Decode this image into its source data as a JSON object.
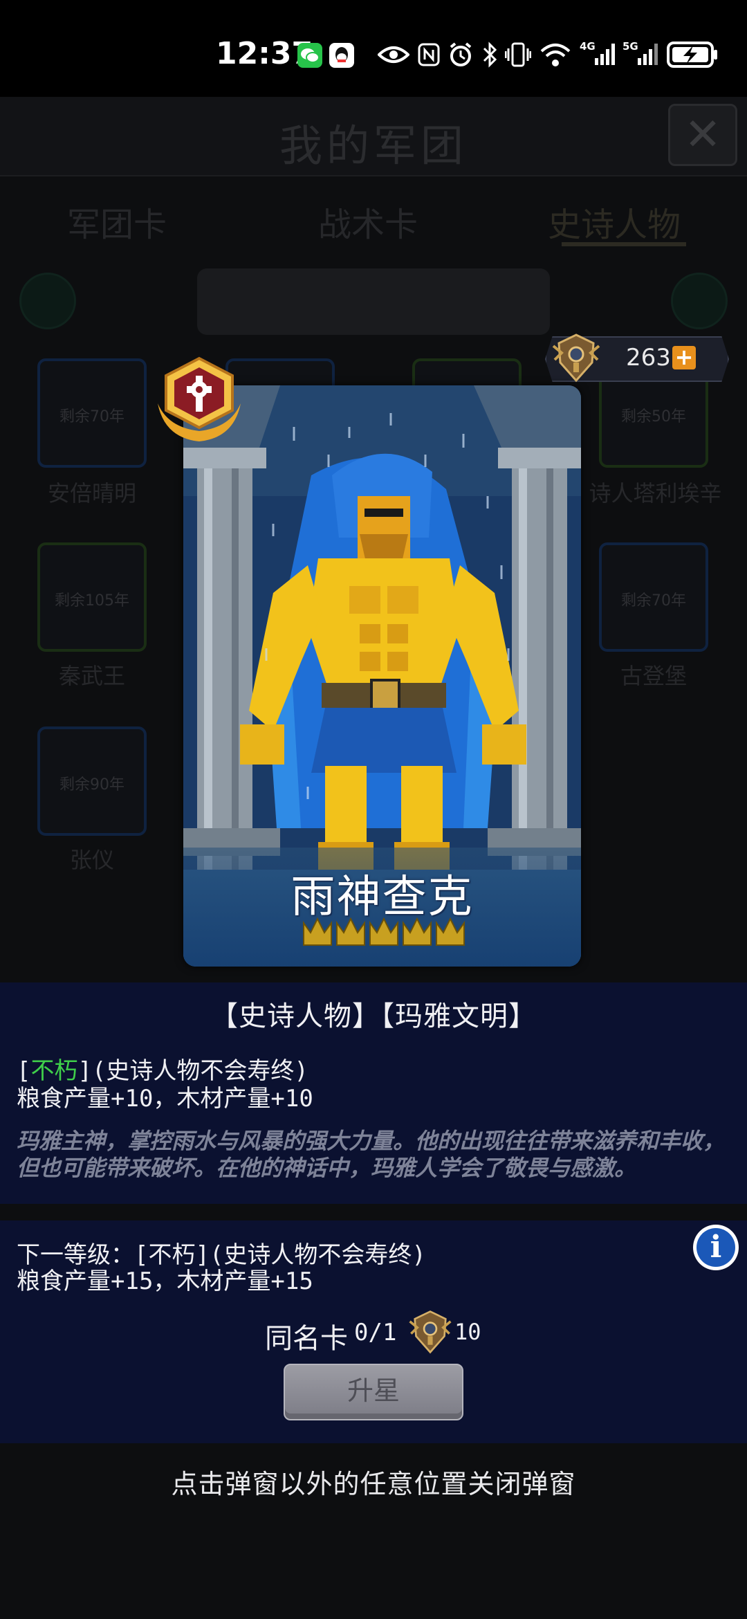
{
  "status_bar": {
    "time": "12:37"
  },
  "background": {
    "title": "我的军团",
    "tabs": [
      "军团卡",
      "战术卡",
      "史诗人物"
    ],
    "cards": [
      {
        "remaining": "剩余70年",
        "name": "安倍晴明"
      },
      {
        "remaining": "剩余50年",
        "name": "诗人塔利埃辛"
      },
      {
        "remaining": "剩余105年",
        "name": "秦武王"
      },
      {
        "remaining": "剩余70年",
        "name": "古登堡"
      },
      {
        "remaining": "剩余90年",
        "name": "张仪"
      }
    ]
  },
  "currency": {
    "value": "263",
    "plus_symbol": "+"
  },
  "hero": {
    "name": "雨神查克",
    "stars": 5
  },
  "details": {
    "tags": "【史诗人物】【玛雅文明】",
    "trait_open": "[",
    "trait_name": "不朽",
    "trait_close": "](史诗人物不会寿终)",
    "yield": "粮食产量+10，木材产量+10",
    "lore": "玛雅主神，掌控雨水与风暴的强大力量。他的出现往往带来滋养和丰收，但也可能带来破坏。在他的神话中，玛雅人学会了敬畏与感激。"
  },
  "upgrade": {
    "next_level": "下一等级：[不朽](史诗人物不会寿终)",
    "next_yield": "粮食产量+15，木材产量+15",
    "dup_label": "同名卡",
    "dup_count": "0/1",
    "cost": "10",
    "star_button": "升星"
  },
  "hint": "点击弹窗以外的任意位置关闭弹窗",
  "colors": {
    "panel_bg": "#0b1130",
    "trait_green": "#3fcf4a",
    "lore_gray": "#7e8398",
    "plus_orange": "#e8901c"
  }
}
